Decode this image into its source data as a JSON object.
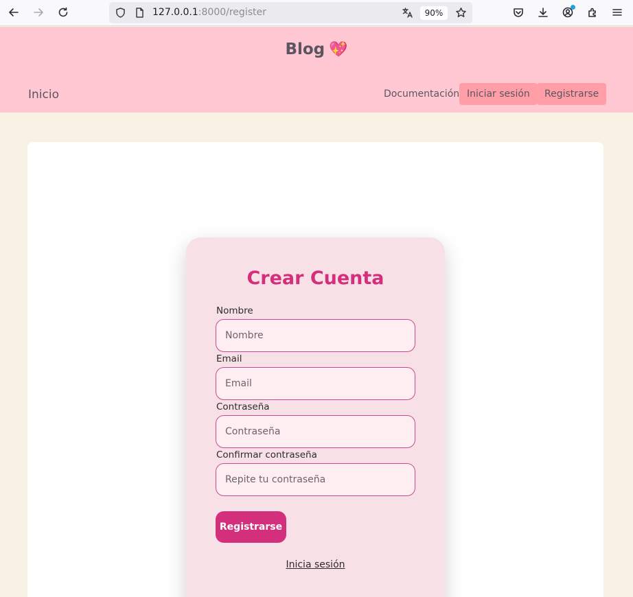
{
  "browser": {
    "url_host": "127.0.0.1",
    "url_path": ":8000/register",
    "zoom": "90%"
  },
  "header": {
    "brand": "Blog",
    "brand_emoji": "💖",
    "nav_home": "Inicio",
    "nav_docs": "Documentación",
    "login_button": "Iniciar sesión",
    "register_button": "Registrarse"
  },
  "form": {
    "title": "Crear Cuenta",
    "fields": [
      {
        "label": "Nombre",
        "placeholder": "Nombre",
        "value": ""
      },
      {
        "label": "Email",
        "placeholder": "Email",
        "value": ""
      },
      {
        "label": "Contraseña",
        "placeholder": "Contraseña",
        "value": ""
      },
      {
        "label": "Confirmar contraseña",
        "placeholder": "Repite tu contraseña",
        "value": ""
      }
    ],
    "submit_label": "Registrarse",
    "login_link": "Inicia sesión"
  },
  "colors": {
    "header_bg": "#ffc8d2",
    "page_bg": "#f7f2e3",
    "nav_button_bg": "#ff9ea6",
    "accent": "#d42f7c",
    "form_bg": "#f7e0e6"
  }
}
